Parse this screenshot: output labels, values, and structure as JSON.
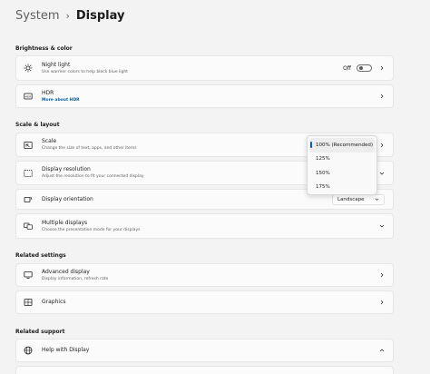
{
  "header": {
    "breadcrumb": "System",
    "title": "Display"
  },
  "sections": {
    "brightness": "Brightness & color",
    "scale_layout": "Scale & layout",
    "related_settings": "Related settings",
    "related_support": "Related support"
  },
  "night_light": {
    "label": "Night light",
    "sub": "Use warmer colors to help block blue light",
    "toggle_state": "Off"
  },
  "hdr": {
    "label": "HDR",
    "link": "More about HDR"
  },
  "scale": {
    "label": "Scale",
    "sub": "Change the size of text, apps, and other items"
  },
  "resolution": {
    "label": "Display resolution",
    "sub": "Adjust the resolution to fit your connected display"
  },
  "orientation": {
    "label": "Display orientation",
    "value": "Landscape"
  },
  "multiple_displays": {
    "label": "Multiple displays",
    "sub": "Choose the presentation mode for your displays"
  },
  "advanced_display": {
    "label": "Advanced display",
    "sub": "Display information, refresh rate"
  },
  "graphics": {
    "label": "Graphics"
  },
  "help_display": {
    "label": "Help with Display"
  },
  "scale_dropdown": {
    "options": [
      "100% (Recommended)",
      "125%",
      "150%",
      "175%"
    ],
    "selected": "100% (Recommended)"
  },
  "colors": {
    "accent": "#005fb8",
    "background": "#f3f3f3",
    "card": "#fbfbfb"
  }
}
